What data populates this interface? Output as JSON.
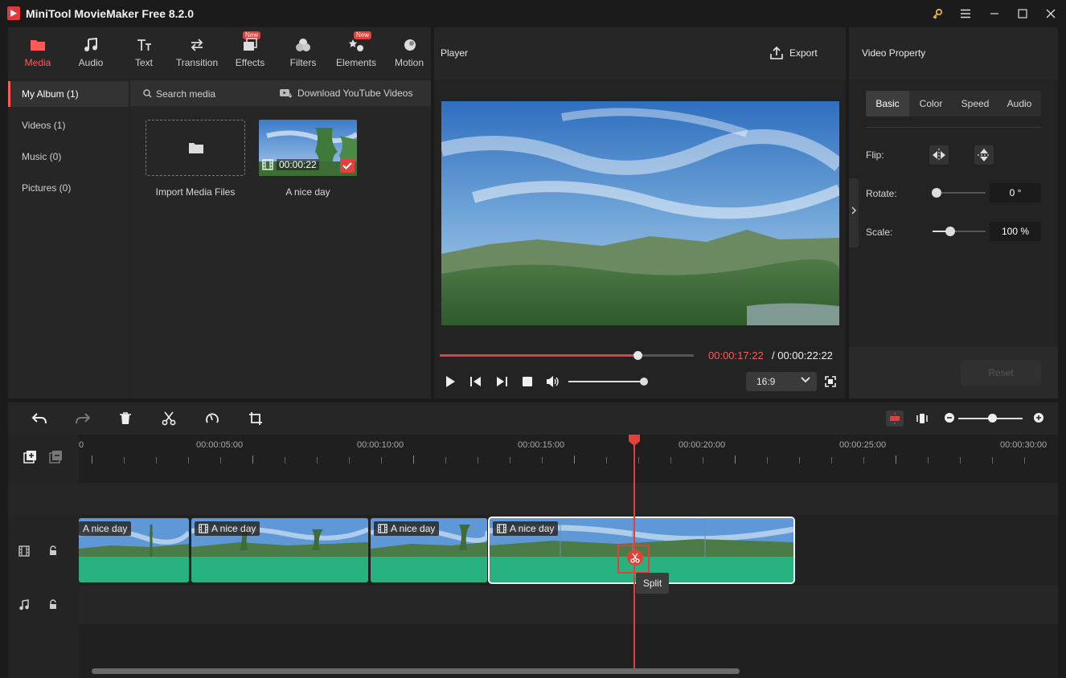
{
  "window": {
    "title": "MiniTool MovieMaker Free 8.2.0",
    "controls": [
      "key-icon",
      "menu-icon",
      "minimize-icon",
      "maximize-icon",
      "close-icon"
    ]
  },
  "toolbar": {
    "items": [
      {
        "label": "Media",
        "icon": "media-icon",
        "active": true
      },
      {
        "label": "Audio",
        "icon": "music-note-icon"
      },
      {
        "label": "Text",
        "icon": "text-icon"
      },
      {
        "label": "Transition",
        "icon": "transition-icon"
      },
      {
        "label": "Effects",
        "icon": "effects-icon",
        "badge": "New"
      },
      {
        "label": "Filters",
        "icon": "filters-icon"
      },
      {
        "label": "Elements",
        "icon": "elements-icon",
        "badge": "New"
      },
      {
        "label": "Motion",
        "icon": "motion-icon"
      }
    ]
  },
  "album": {
    "items": [
      "My Album (1)",
      "Videos (1)",
      "Music (0)",
      "Pictures (0)"
    ]
  },
  "media": {
    "search_placeholder": "Search media",
    "download_label": "Download YouTube Videos",
    "import_label": "Import Media Files",
    "clip_name": "A nice day",
    "clip_duration": "00:00:22"
  },
  "player": {
    "title": "Player",
    "export_label": "Export",
    "current_time": "00:00:17:22",
    "total_time": "/ 00:00:22:22",
    "progress": 0.78,
    "volume": 0.95,
    "aspect_ratio": "16:9"
  },
  "property": {
    "title": "Video Property",
    "tabs": [
      "Basic",
      "Color",
      "Speed",
      "Audio"
    ],
    "active_tab": "Basic",
    "flip_label": "Flip:",
    "rotate_label": "Rotate:",
    "rotate_value": "0 °",
    "scale_label": "Scale:",
    "scale_value": "100 %",
    "reset_label": "Reset"
  },
  "timeline": {
    "ruler": [
      "0",
      "00:00:05:00",
      "00:00:10:00",
      "00:00:15:00",
      "00:00:20:00",
      "00:00:25:00",
      "00:00:30:00"
    ],
    "clips": [
      {
        "name": "A nice day"
      },
      {
        "name": "A nice day"
      },
      {
        "name": "A nice day"
      },
      {
        "name": "A nice day",
        "selected": true
      }
    ],
    "split_tooltip": "Split"
  },
  "colors": {
    "accent": "#e2413b",
    "clip_wave": "#29b17f",
    "panel": "#262626"
  }
}
